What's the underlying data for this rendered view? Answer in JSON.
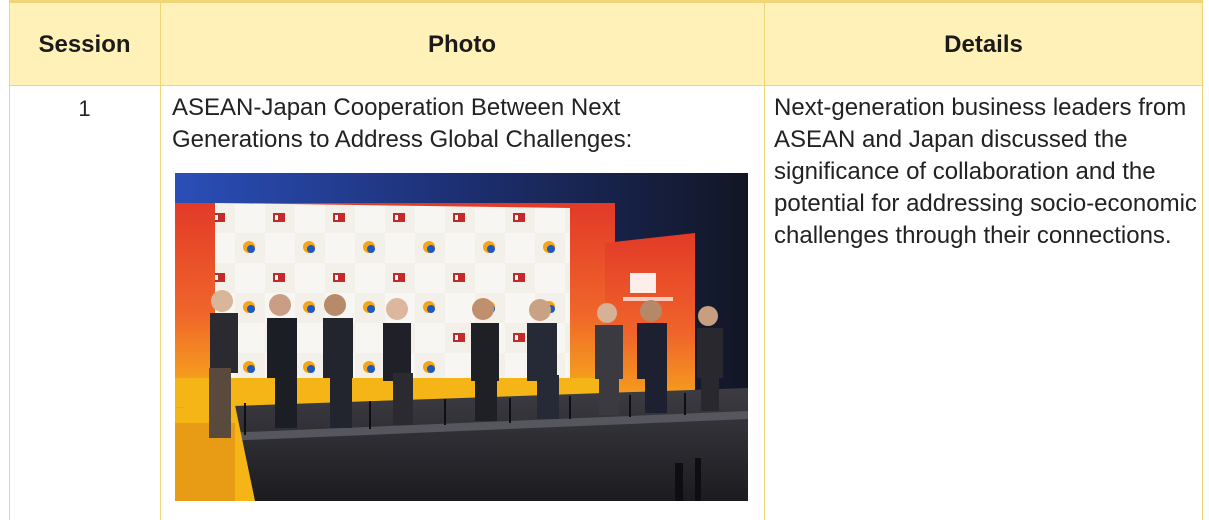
{
  "table": {
    "headers": {
      "session": "Session",
      "photo": "Photo",
      "details": "Details"
    },
    "row": {
      "session": "1",
      "caption": "ASEAN-Japan Cooperation Between Next Generations to Address Global Challenges:",
      "details": "Next-generation business leaders from ASEAN and Japan discussed the significance of collaboration and the potential for addressing socio-economic challenges through their connections."
    }
  },
  "colors": {
    "header_bg": "#fff1b8",
    "border": "#f2d479",
    "text": "#222222"
  },
  "photo": {
    "panelists": 9
  }
}
